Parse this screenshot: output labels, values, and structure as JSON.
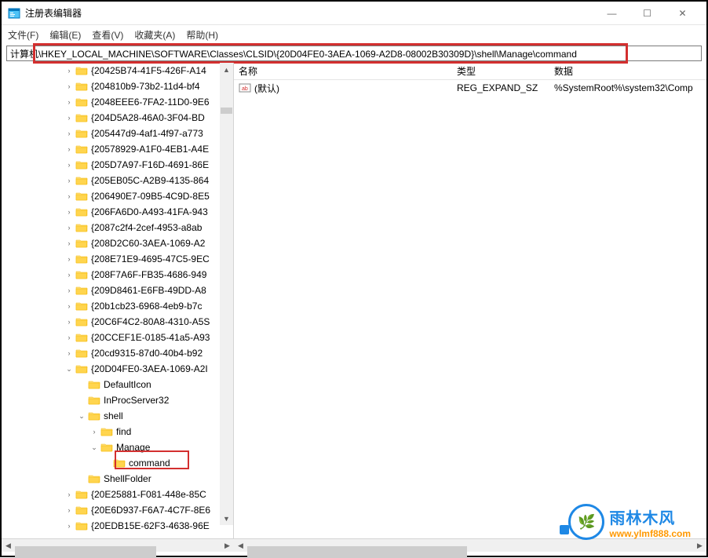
{
  "window": {
    "title": "注册表编辑器"
  },
  "menu": {
    "file": "文件(F)",
    "edit": "编辑(E)",
    "view": "查看(V)",
    "favorites": "收藏夹(A)",
    "help": "帮助(H)"
  },
  "address": {
    "path": "计算机\\HKEY_LOCAL_MACHINE\\SOFTWARE\\Classes\\CLSID\\{20D04FE0-3AEA-1069-A2D8-08002B30309D}\\shell\\Manage\\command"
  },
  "list": {
    "headers": {
      "name": "名称",
      "type": "类型",
      "data": "数据"
    },
    "rows": [
      {
        "name": "(默认)",
        "type": "REG_EXPAND_SZ",
        "data": "%SystemRoot%\\system32\\Comp"
      }
    ]
  },
  "tree": {
    "items": [
      {
        "indent": 5,
        "toggle": ">",
        "label": "{20425B74-41F5-426F-A14"
      },
      {
        "indent": 5,
        "toggle": ">",
        "label": "{204810b9-73b2-11d4-bf4"
      },
      {
        "indent": 5,
        "toggle": ">",
        "label": "{2048EEE6-7FA2-11D0-9E6"
      },
      {
        "indent": 5,
        "toggle": ">",
        "label": "{204D5A28-46A0-3F04-BD"
      },
      {
        "indent": 5,
        "toggle": ">",
        "label": "{205447d9-4af1-4f97-a773"
      },
      {
        "indent": 5,
        "toggle": ">",
        "label": "{20578929-A1F0-4EB1-A4E"
      },
      {
        "indent": 5,
        "toggle": ">",
        "label": "{205D7A97-F16D-4691-86E"
      },
      {
        "indent": 5,
        "toggle": ">",
        "label": "{205EB05C-A2B9-4135-864"
      },
      {
        "indent": 5,
        "toggle": ">",
        "label": "{206490E7-09B5-4C9D-8E5"
      },
      {
        "indent": 5,
        "toggle": ">",
        "label": "{206FA6D0-A493-41FA-943"
      },
      {
        "indent": 5,
        "toggle": ">",
        "label": "{2087c2f4-2cef-4953-a8ab"
      },
      {
        "indent": 5,
        "toggle": ">",
        "label": "{208D2C60-3AEA-1069-A2"
      },
      {
        "indent": 5,
        "toggle": ">",
        "label": "{208E71E9-4695-47C5-9EC"
      },
      {
        "indent": 5,
        "toggle": ">",
        "label": "{208F7A6F-FB35-4686-949"
      },
      {
        "indent": 5,
        "toggle": ">",
        "label": "{209D8461-E6FB-49DD-A8"
      },
      {
        "indent": 5,
        "toggle": ">",
        "label": "{20b1cb23-6968-4eb9-b7c"
      },
      {
        "indent": 5,
        "toggle": ">",
        "label": "{20C6F4C2-80A8-4310-A5S"
      },
      {
        "indent": 5,
        "toggle": ">",
        "label": "{20CCEF1E-0185-41a5-A93"
      },
      {
        "indent": 5,
        "toggle": ">",
        "label": "{20cd9315-87d0-40b4-b92"
      },
      {
        "indent": 5,
        "toggle": "v",
        "label": "{20D04FE0-3AEA-1069-A2I"
      },
      {
        "indent": 6,
        "toggle": "",
        "label": "DefaultIcon"
      },
      {
        "indent": 6,
        "toggle": "",
        "label": "InProcServer32"
      },
      {
        "indent": 6,
        "toggle": "v",
        "label": "shell"
      },
      {
        "indent": 7,
        "toggle": ">",
        "label": "find"
      },
      {
        "indent": 7,
        "toggle": "v",
        "label": "Manage"
      },
      {
        "indent": 8,
        "toggle": "",
        "label": "command",
        "selected": true
      },
      {
        "indent": 6,
        "toggle": "",
        "label": "ShellFolder"
      },
      {
        "indent": 5,
        "toggle": ">",
        "label": "{20E25881-F081-448e-85C"
      },
      {
        "indent": 5,
        "toggle": ">",
        "label": "{20E6D937-F6A7-4C7F-8E6"
      },
      {
        "indent": 5,
        "toggle": ">",
        "label": "{20EDB15E-62F3-4638-96E"
      }
    ]
  },
  "watermark": {
    "brand": "雨林木风",
    "url": "www.ylmf888.com"
  }
}
